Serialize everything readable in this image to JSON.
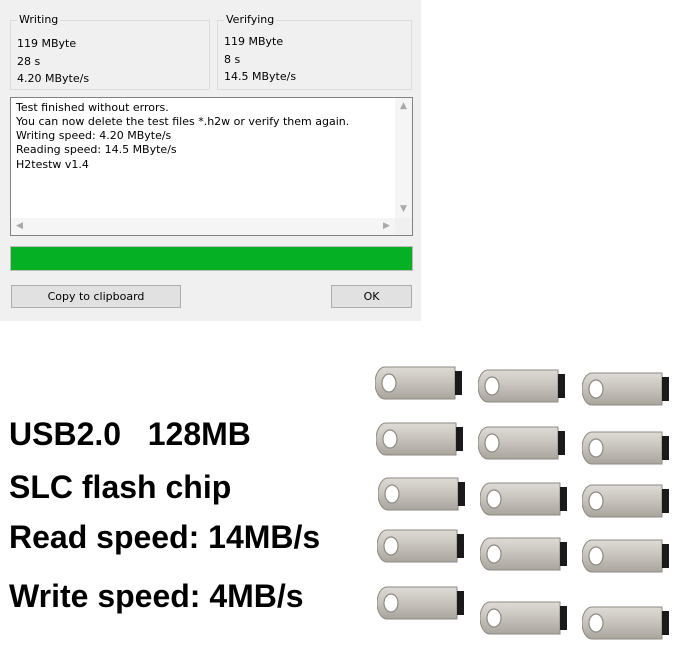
{
  "dialog": {
    "writing": {
      "title": "Writing",
      "amount": "119 MByte",
      "time": "28 s",
      "speed": "4.20 MByte/s"
    },
    "verifying": {
      "title": "Verifying",
      "amount": "119 MByte",
      "time": "8 s",
      "speed": "14.5 MByte/s"
    },
    "log_lines": [
      "Test finished without errors.",
      "You can now delete the test files *.h2w or verify them again.",
      "Writing speed: 4.20 MByte/s",
      "Reading speed: 14.5 MByte/s",
      "H2testw v1.4"
    ],
    "progress_fraction": 1.0,
    "progress_color": "#06b025",
    "copy_button_label": "Copy to clipboard",
    "ok_button_label": "OK"
  },
  "product": {
    "line1": "USB2.0   128MB",
    "line2": "SLC flash chip",
    "line3": "Read speed: 14MB/s",
    "line4": "Write speed: 4MB/s"
  },
  "drive_count": 15,
  "drive_icon": "usb-flash-drive-icon"
}
